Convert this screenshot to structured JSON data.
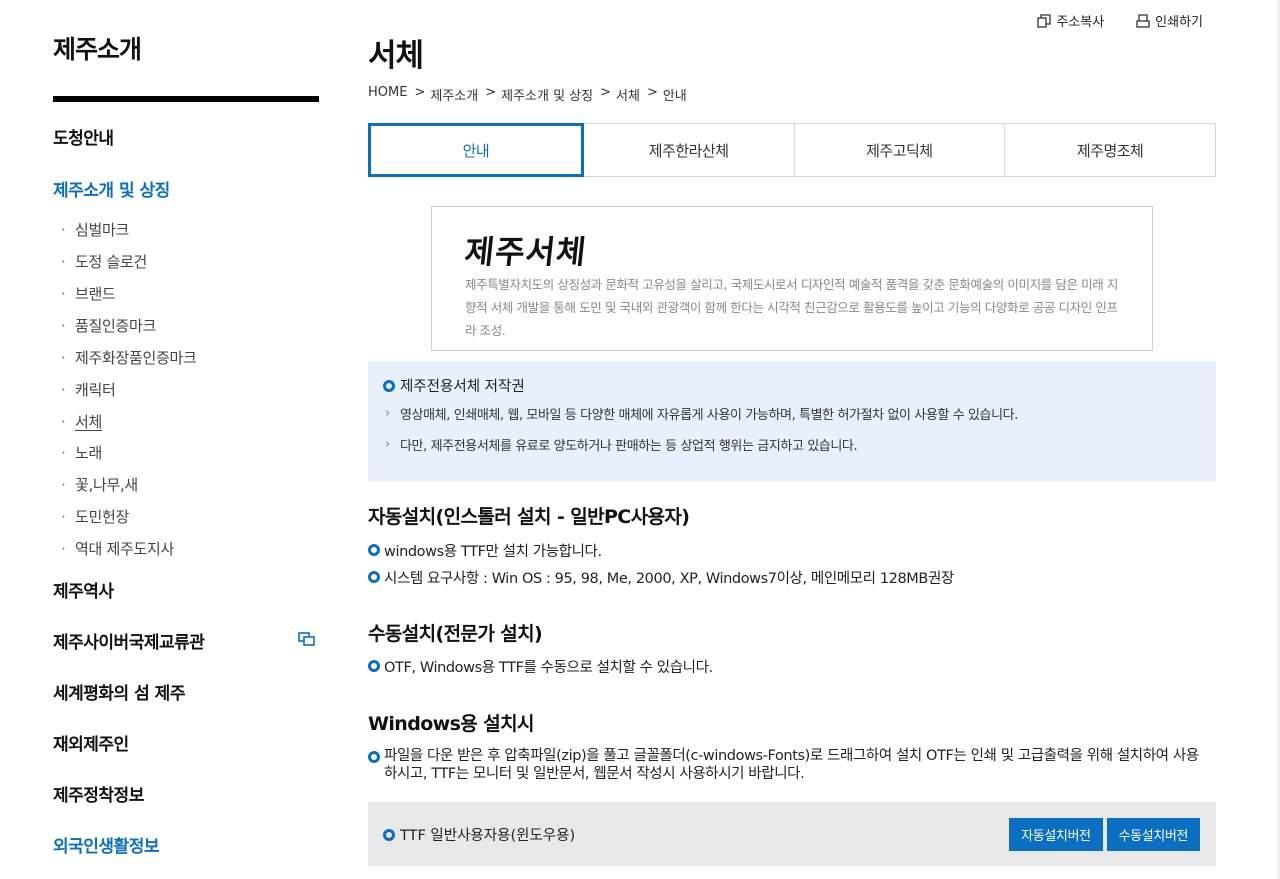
{
  "sidebar": {
    "title": "제주소개",
    "items": [
      {
        "label": "도청안내"
      },
      {
        "label": "제주소개 및 상징"
      },
      {
        "label": "제주역사"
      },
      {
        "label": "제주사이버국제교류관"
      },
      {
        "label": "세계평화의 섬 제주"
      },
      {
        "label": "재외제주인"
      },
      {
        "label": "제주정착정보"
      },
      {
        "label": "외국인생활정보"
      }
    ],
    "sub_items": [
      {
        "label": "심벌마크"
      },
      {
        "label": "도정 슬로건"
      },
      {
        "label": "브랜드"
      },
      {
        "label": "품질인증마크"
      },
      {
        "label": "제주화장품인증마크"
      },
      {
        "label": "캐릭터"
      },
      {
        "label": "서체"
      },
      {
        "label": "노래"
      },
      {
        "label": "꽃,나무,새"
      },
      {
        "label": "도민헌장"
      },
      {
        "label": "역대 제주도지사"
      }
    ],
    "bullet": "·"
  },
  "utils": {
    "copy_url": "주소복사",
    "print": "인쇄하기"
  },
  "main": {
    "title": "서체",
    "breadcrumb": [
      "HOME",
      "제주소개",
      "제주소개 및 상징",
      "서체",
      "안내"
    ],
    "breadcrumb_sep": ">",
    "tabs": [
      {
        "label": "안내"
      },
      {
        "label": "제주한라산체"
      },
      {
        "label": "제주고딕체"
      },
      {
        "label": "제주명조체"
      }
    ],
    "font_box": {
      "logo": "제주서체",
      "desc": "제주특별자치도의 상징성과 문화적 고유성을 살리고, 국제도시로서 디자인적 예술적 품격을 갖춘 문화예술의 이미지를 담은 미래 지향적 서체 개발을 통해 도민 및 국내외 관광객이 함께 한다는 시각적 친근감으로 활용도를 높이고 기능의 다양화로 공공 디자인 인프라 조성."
    },
    "copyright": {
      "heading": "제주전용서체 저작권",
      "lines": [
        "영상매체, 인쇄매체, 웹, 모바일 등 다양한 매체에 자유롭게 사용이 가능하며, 특별한 허가절차 없이 사용할 수 있습니다.",
        "다만, 제주전용서체를 유료로 양도하거나 판매하는 등 상업적 행위는 금지하고 있습니다."
      ]
    },
    "sections": {
      "auto": {
        "title": "자동설치(인스톨러 설치 - 일반PC사용자)",
        "bullets": [
          "windows용 TTF만 설치 가능합니다.",
          "시스템 요구사항 : Win OS : 95, 98, Me, 2000, XP, Windows7이상, 메인메모리 128MB권장"
        ]
      },
      "manual": {
        "title": "수동설치(전문가 설치)",
        "bullets": [
          "OTF, Windows용 TTF를 수동으로 설치할 수 있습니다."
        ]
      },
      "windows": {
        "title": "Windows용 설치시",
        "bullets": [
          "파일을 다운 받은 후 압축파일(zip)을 풀고 글꼴폴더(c-windows-Fonts)로 드래그하여 설치 OTF는 인쇄 및 고급출력을 위해 설치하여 사용하시고, TTF는 모니터 및 일반문서, 웹문서 작성시 사용하시기 바랍니다."
        ]
      }
    },
    "download": {
      "label": "TTF 일반사용자용(윈도우용)",
      "auto_btn": "자동설치버전",
      "manual_btn": "수동설치버전"
    }
  },
  "colors": {
    "accent": "#0b6fc1",
    "info_bg": "#e8f0fc",
    "download_bg": "#e8e8e8"
  },
  "icons": {
    "copy": "copy-icon",
    "print": "print-icon",
    "external": "new-window-icon",
    "chevron": "chevron-right-icon"
  }
}
